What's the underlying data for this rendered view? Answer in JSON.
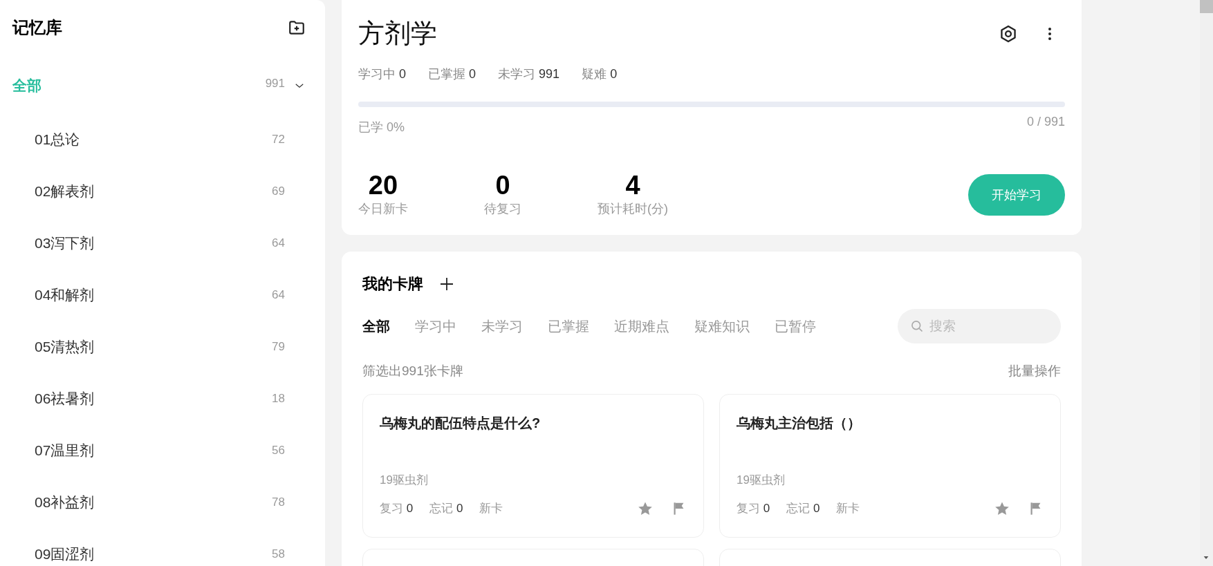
{
  "sidebar": {
    "title": "记忆库",
    "root": {
      "label": "全部",
      "count": "991",
      "expanded": true,
      "selected": true
    },
    "items": [
      {
        "label": "01总论",
        "count": "72",
        "selected": false
      },
      {
        "label": "02解表剂",
        "count": "69",
        "selected": false
      },
      {
        "label": "03泻下剂",
        "count": "64",
        "selected": false
      },
      {
        "label": "04和解剂",
        "count": "64",
        "selected": false
      },
      {
        "label": "05清热剂",
        "count": "79",
        "selected": false
      },
      {
        "label": "06祛暑剂",
        "count": "18",
        "selected": false
      },
      {
        "label": "07温里剂",
        "count": "56",
        "selected": false
      },
      {
        "label": "08补益剂",
        "count": "78",
        "selected": false
      },
      {
        "label": "09固涩剂",
        "count": "58",
        "selected": false
      }
    ]
  },
  "deck": {
    "title": "方剂学",
    "stats": [
      {
        "label": "学习中",
        "value": "0"
      },
      {
        "label": "已掌握",
        "value": "0"
      },
      {
        "label": "未学习",
        "value": "991"
      },
      {
        "label": "疑难",
        "value": "0"
      }
    ],
    "progress": {
      "level": 0,
      "label": "已学 0%",
      "reading": "0 / 991"
    },
    "today": [
      {
        "value": "20",
        "label": "今日新卡"
      },
      {
        "value": "0",
        "label": "待复习"
      },
      {
        "value": "4",
        "label": "预计耗时(分)"
      }
    ],
    "start_button": "开始学习"
  },
  "cards_section": {
    "title": "我的卡牌",
    "tabs": [
      {
        "label": "全部",
        "selected": true
      },
      {
        "label": "学习中",
        "selected": false
      },
      {
        "label": "未学习",
        "selected": false
      },
      {
        "label": "已掌握",
        "selected": false
      },
      {
        "label": "近期难点",
        "selected": false
      },
      {
        "label": "疑难知识",
        "selected": false
      },
      {
        "label": "已暂停",
        "selected": false
      }
    ],
    "search": {
      "placeholder": "搜索"
    },
    "filter_summary": "筛选出991张卡牌",
    "batch_action": "批量操作",
    "cards": [
      {
        "question": "乌梅丸的配伍特点是什么?",
        "category": "19驱虫剂",
        "review_label": "复习",
        "review": "0",
        "forget_label": "忘记",
        "forget": "0",
        "status": "新卡"
      },
      {
        "question": "乌梅丸主治包括（）",
        "category": "19驱虫剂",
        "review_label": "复习",
        "review": "0",
        "forget_label": "忘记",
        "forget": "0",
        "status": "新卡"
      }
    ]
  }
}
